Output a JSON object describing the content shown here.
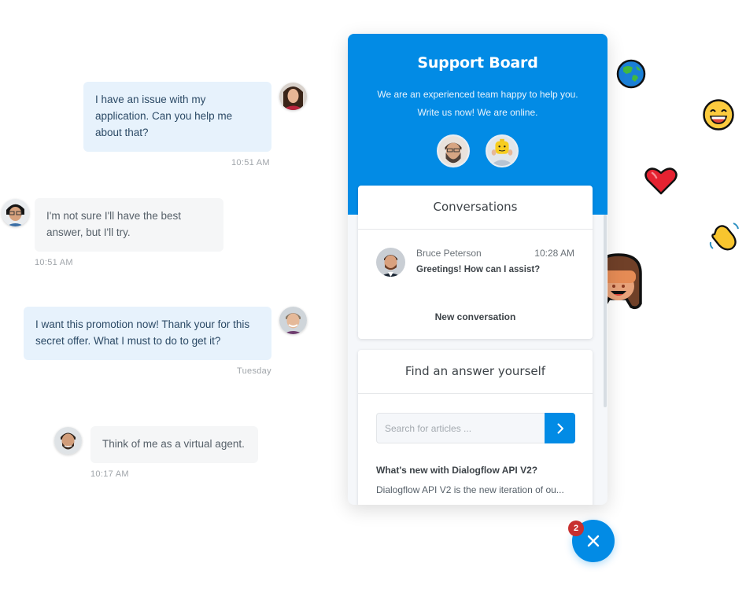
{
  "chat_demo": {
    "messages": [
      {
        "side": "user",
        "text": "I have an issue with my application. Can you help me about that?",
        "time": "10:51 AM",
        "avatar": "woman-avatar"
      },
      {
        "side": "agent",
        "text": "I'm not sure I'll have the best answer, but I'll try.",
        "time": "10:51 AM",
        "avatar": "man-glasses-avatar"
      },
      {
        "side": "user",
        "text": "I want this promotion now! Thank your for this secret offer. What I must to do to get it?",
        "time": "Tuesday",
        "avatar": "man-avatar"
      },
      {
        "side": "agent",
        "text": "Think of me as a virtual agent.",
        "time": "10:17 AM",
        "avatar": "bearded-man-avatar"
      }
    ]
  },
  "emojis": [
    "globe-emoji",
    "grinning-face-emoji",
    "red-heart-emoji",
    "waving-hand-emoji",
    "see-no-evil-monkey-emoji"
  ],
  "panel": {
    "title": "Support Board",
    "description_line1": "We are an experienced team happy to help you.",
    "description_line2": "Write us now! We are online.",
    "agents": [
      "bearded-agent-avatar",
      "lego-agent-avatar"
    ],
    "conversations": {
      "title": "Conversations",
      "items": [
        {
          "name": "Bruce Peterson",
          "time": "10:28 AM",
          "message": "Greetings! How can I assist?"
        }
      ],
      "new_conversation_label": "New conversation"
    },
    "find_answer": {
      "title": "Find an answer yourself",
      "search_placeholder": "Search for articles ...",
      "articles": [
        {
          "title": "What's new with Dialogflow API V2?",
          "excerpt": "Dialogflow API V2 is the new iteration of ou..."
        }
      ]
    }
  },
  "launcher": {
    "badge_count": "2",
    "icon": "close-icon"
  },
  "colors": {
    "brand": "#028be5",
    "badge": "#c8302f",
    "user_bubble": "#e7f2fc",
    "agent_bubble": "#f5f6f7"
  }
}
